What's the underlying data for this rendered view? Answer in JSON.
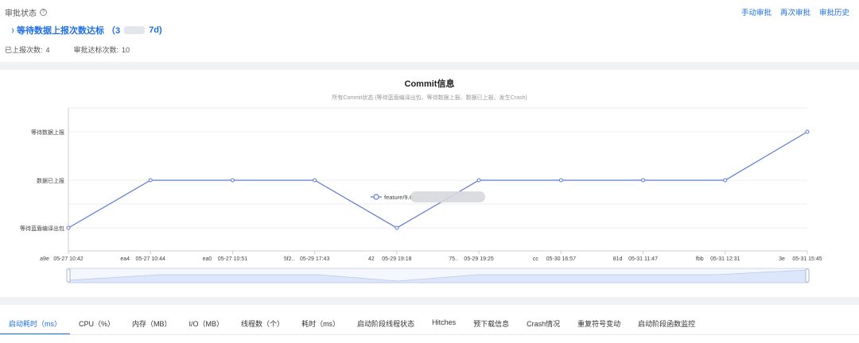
{
  "approval": {
    "status_label": "审批状态",
    "help_icon": "?",
    "actions": [
      "手动审批",
      "再次审批",
      "审批历史"
    ],
    "pending_prefix": "等待数据上报次数达标 （3",
    "pending_suffix": "7d)",
    "reported_label": "已上报次数:",
    "reported_value": "4",
    "target_label": "审批达标次数:",
    "target_value": "10"
  },
  "chart_data": {
    "type": "line",
    "title": "Commit信息",
    "subtitle": "所有Commit状态 (等待蓝盾编译出包、等待数据上报、数据已上报、发生Crash)",
    "y_categories": [
      "等待蓝盾编译出包",
      "数据已上报",
      "等待数据上报"
    ],
    "x": [
      {
        "id": "a9e",
        "time": "05-27 10:42"
      },
      {
        "id": "ea4",
        "time": "05-27 10:44"
      },
      {
        "id": "ea0",
        "time": "05-27 10:51"
      },
      {
        "id": "5f2..",
        "time": "05-29 17:43"
      },
      {
        "id": "42",
        "time": "05-29 19:18"
      },
      {
        "id": "75..",
        "time": "05-29 19:25"
      },
      {
        "id": "cc",
        "time": "05-30 16:57"
      },
      {
        "id": "81d",
        "time": "05-31 11:47"
      },
      {
        "id": "fbb",
        "time": "05-31 12:31"
      },
      {
        "id": "3e",
        "time": "05-31 15:45"
      }
    ],
    "series": [
      {
        "values": [
          "等待蓝盾编译出包",
          "数据已上报",
          "数据已上报",
          "数据已上报",
          "等待蓝盾编译出包",
          "数据已上报",
          "数据已上报",
          "数据已上报",
          "数据已上报",
          "等待数据上报"
        ]
      }
    ],
    "tooltip": "feature/9.6",
    "grid": true,
    "colors": {
      "line": "#5b7bd5",
      "grid": "#ececec",
      "zoom_fill": "#dde7fb"
    }
  },
  "tabs": [
    {
      "label": "启动耗时（ms）",
      "active": true
    },
    {
      "label": "CPU（%）",
      "active": false
    },
    {
      "label": "内存（MB）",
      "active": false
    },
    {
      "label": "I/O（MB）",
      "active": false
    },
    {
      "label": "线程数（个）",
      "active": false
    },
    {
      "label": "耗时（ms）",
      "active": false
    },
    {
      "label": "启动阶段线程状态",
      "active": false
    },
    {
      "label": "Hitches",
      "active": false
    },
    {
      "label": "预下载信息",
      "active": false
    },
    {
      "label": "Crash情况",
      "active": false
    },
    {
      "label": "重复符号变动",
      "active": false
    },
    {
      "label": "启动阶段函数监控",
      "active": false
    }
  ]
}
